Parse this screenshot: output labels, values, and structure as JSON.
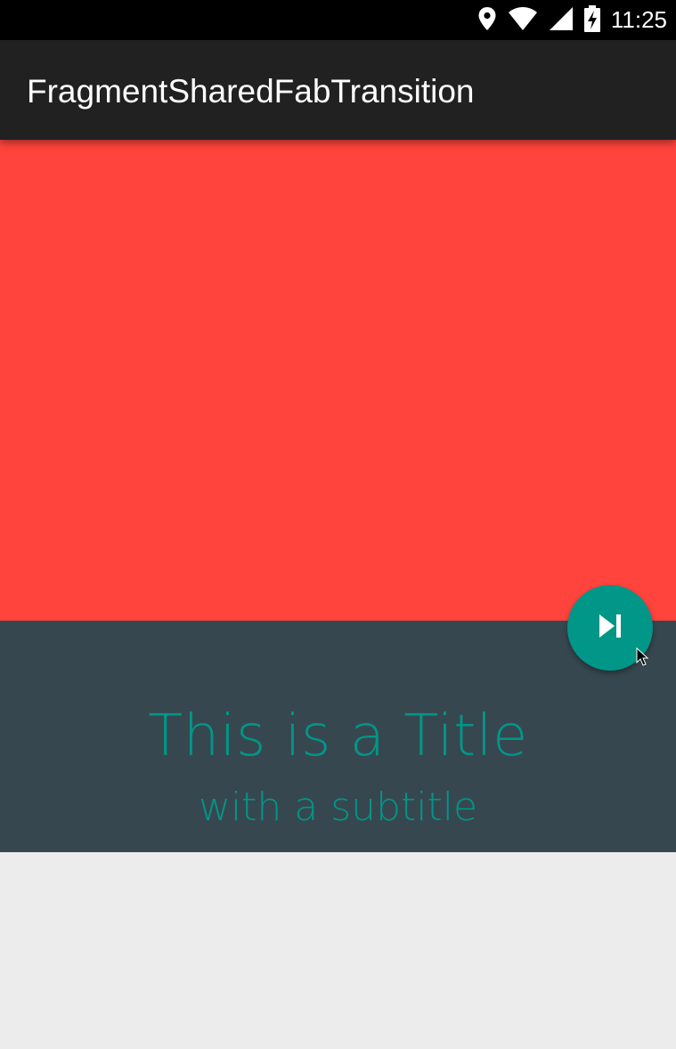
{
  "status_bar": {
    "time": "11:25",
    "icons": [
      "location-icon",
      "wifi-icon",
      "cellular-signal-icon",
      "battery-charging-icon"
    ]
  },
  "toolbar": {
    "title": "FragmentSharedFabTransition"
  },
  "header_panel": {
    "title": "This is a Title",
    "subtitle": "with a subtitle"
  },
  "fab": {
    "icon": "skip-next-icon"
  },
  "colors": {
    "status_bar": "#000000",
    "toolbar": "#212121",
    "hero": "#ff433d",
    "panel": "#37474f",
    "accent": "#009688",
    "background": "#ececec",
    "on_dark": "#ffffff"
  }
}
